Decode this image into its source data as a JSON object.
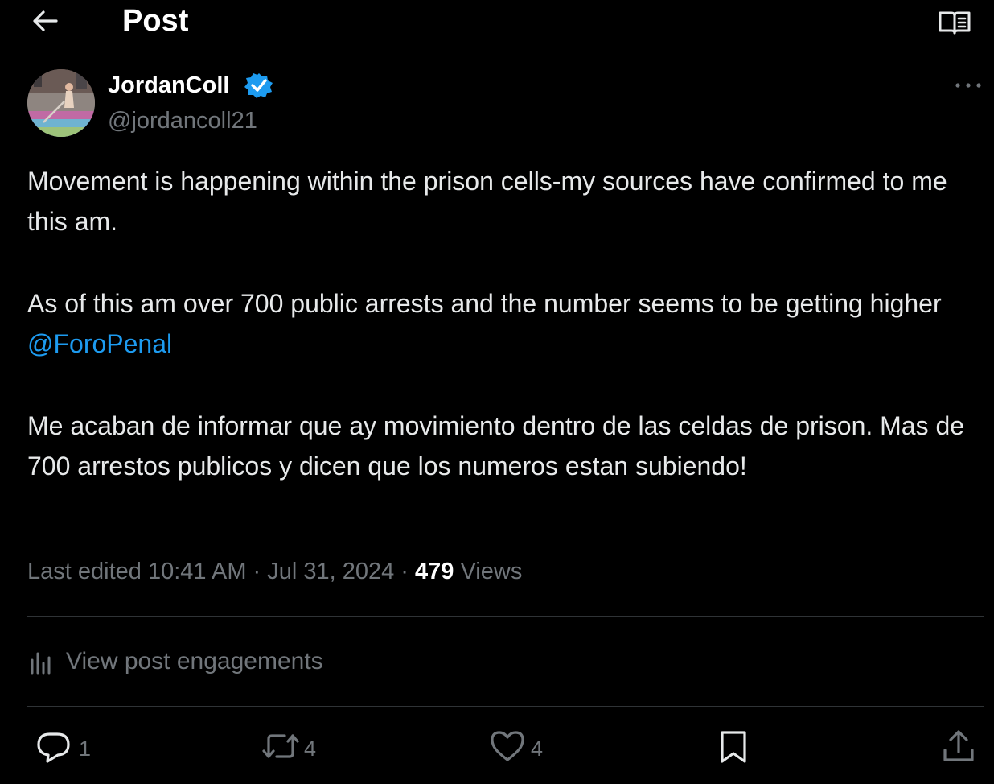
{
  "header": {
    "back_icon": "arrow-left-icon",
    "title": "Post",
    "reader_icon": "reader-mode-icon"
  },
  "author": {
    "name": "JordanColl",
    "handle": "@jordancoll21",
    "verified_icon": "verified-badge-icon",
    "more_icon": "more-horizontal-icon"
  },
  "post": {
    "p1": "Movement is happening within the prison cells-my sources have confirmed to me this am.",
    "p2_text": "As of this am over 700 public arrests and the number seems to be getting higher",
    "p2_mention": "@ForoPenal",
    "p3": "Me acaban de informar que ay movimiento dentro de las celdas de prison. Mas de 700 arrestos publicos y dicen que los numeros estan subiendo!"
  },
  "meta": {
    "prefix": "Last edited 10:41 AM · Jul 31, 2024 ·",
    "views_count": "479",
    "views_label": "Views"
  },
  "engagements": {
    "icon": "bar-chart-icon",
    "label": "View post engagements"
  },
  "actions": {
    "reply": {
      "icon": "reply-icon",
      "count": "1"
    },
    "repost": {
      "icon": "repost-icon",
      "count": "4"
    },
    "like": {
      "icon": "heart-icon",
      "count": "4"
    },
    "bookmark": {
      "icon": "bookmark-icon"
    },
    "share": {
      "icon": "share-icon"
    }
  },
  "colors": {
    "background": "#000000",
    "text": "#e7e9ea",
    "secondary": "#71767b",
    "accent": "#1d9bf0",
    "divider": "#2f3336"
  }
}
